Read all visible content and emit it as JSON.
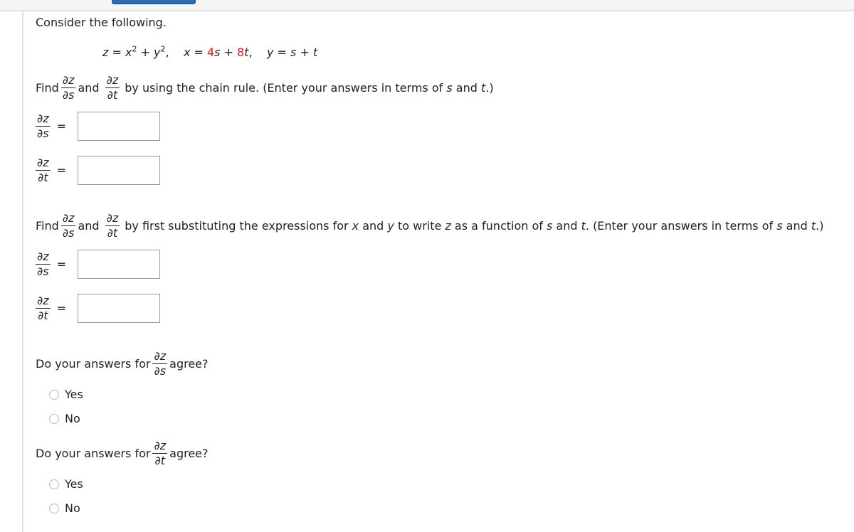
{
  "header": {
    "button_label": ""
  },
  "intro": "Consider the following.",
  "equation": {
    "z_lhs": "z",
    "eq": " = ",
    "x2": "x",
    "plus": " + ",
    "y2": "y",
    "exp": "2",
    "sep": ",",
    "x_lhs": "x",
    "x_coef1": "4",
    "x_var1": "s",
    "x_coef2": "8",
    "x_var2": "t",
    "y_lhs": "y",
    "y_var1": "s",
    "y_var2": "t"
  },
  "part1": {
    "find": "Find",
    "and": "and",
    "instruction_text": "by using the chain rule. (Enter your answers in terms of ",
    "var_s": "s",
    "and2": " and ",
    "var_t": "t",
    "close": ".)"
  },
  "part2": {
    "find": "Find",
    "and": "and",
    "t1": "by first substituting the expressions for ",
    "x": "x",
    "t2": " and ",
    "y": "y",
    "t3": " to write ",
    "z": "z",
    "t4": " as a function of ",
    "s": "s",
    "t5": " and ",
    "t": "t",
    "t6": ". (Enter your answers in terms of ",
    "s2": "s",
    "t7": " and ",
    "tt": "t",
    "t8": ".)"
  },
  "deriv": {
    "num": "∂z",
    "den_s": "∂s",
    "den_t": "∂t",
    "equals": "="
  },
  "answers": {
    "dz_ds_chain": "",
    "dz_dt_chain": "",
    "dz_ds_sub": "",
    "dz_dt_sub": ""
  },
  "question1": {
    "prefix": "Do your answers for",
    "suffix": "agree?",
    "options": [
      "Yes",
      "No"
    ]
  },
  "question2": {
    "prefix": "Do your answers for",
    "suffix": "agree?",
    "options": [
      "Yes",
      "No"
    ]
  },
  "colors": {
    "accent_red": "#e4141b",
    "button_blue": "#2c6fae"
  }
}
